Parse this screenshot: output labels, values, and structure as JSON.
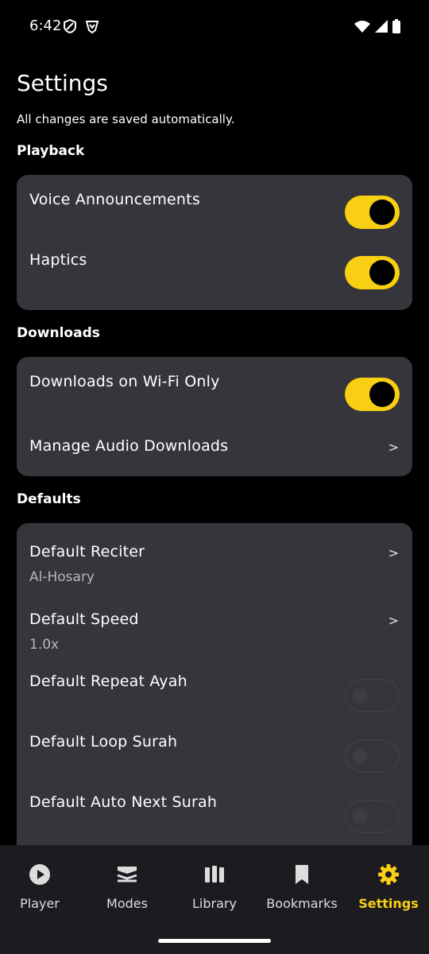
{
  "status_bar": {
    "time": "6:42"
  },
  "header": {
    "title": "Settings",
    "subtitle": "All changes are saved automatically."
  },
  "sections": {
    "playback": {
      "title": "Playback",
      "voice_announcements": {
        "label": "Voice Announcements",
        "enabled": true
      },
      "haptics": {
        "label": "Haptics",
        "enabled": true
      }
    },
    "downloads": {
      "title": "Downloads",
      "wifi_only": {
        "label": "Downloads on Wi-Fi Only",
        "enabled": true
      },
      "manage": {
        "label": "Manage Audio Downloads",
        "chevron": ">"
      }
    },
    "defaults": {
      "title": "Defaults",
      "reciter": {
        "label": "Default Reciter",
        "value": "Al-Hosary",
        "chevron": ">"
      },
      "speed": {
        "label": "Default Speed",
        "value": "1.0x",
        "chevron": ">"
      },
      "repeat_ayah": {
        "label": "Default Repeat Ayah",
        "enabled": false
      },
      "loop_surah": {
        "label": "Default Loop Surah",
        "enabled": false
      },
      "auto_next": {
        "label": "Default Auto Next Surah",
        "enabled": false
      }
    }
  },
  "bottom_nav": {
    "items": [
      {
        "label": "Player",
        "icon": "play-circle-icon"
      },
      {
        "label": "Modes",
        "icon": "layers-icon"
      },
      {
        "label": "Library",
        "icon": "library-icon"
      },
      {
        "label": "Bookmarks",
        "icon": "bookmark-icon"
      },
      {
        "label": "Settings",
        "icon": "gear-icon",
        "active": true
      }
    ]
  },
  "colors": {
    "accent": "#f8cf12",
    "card": "#36353b",
    "background": "#000000",
    "nav_background": "#1c1b1f"
  }
}
